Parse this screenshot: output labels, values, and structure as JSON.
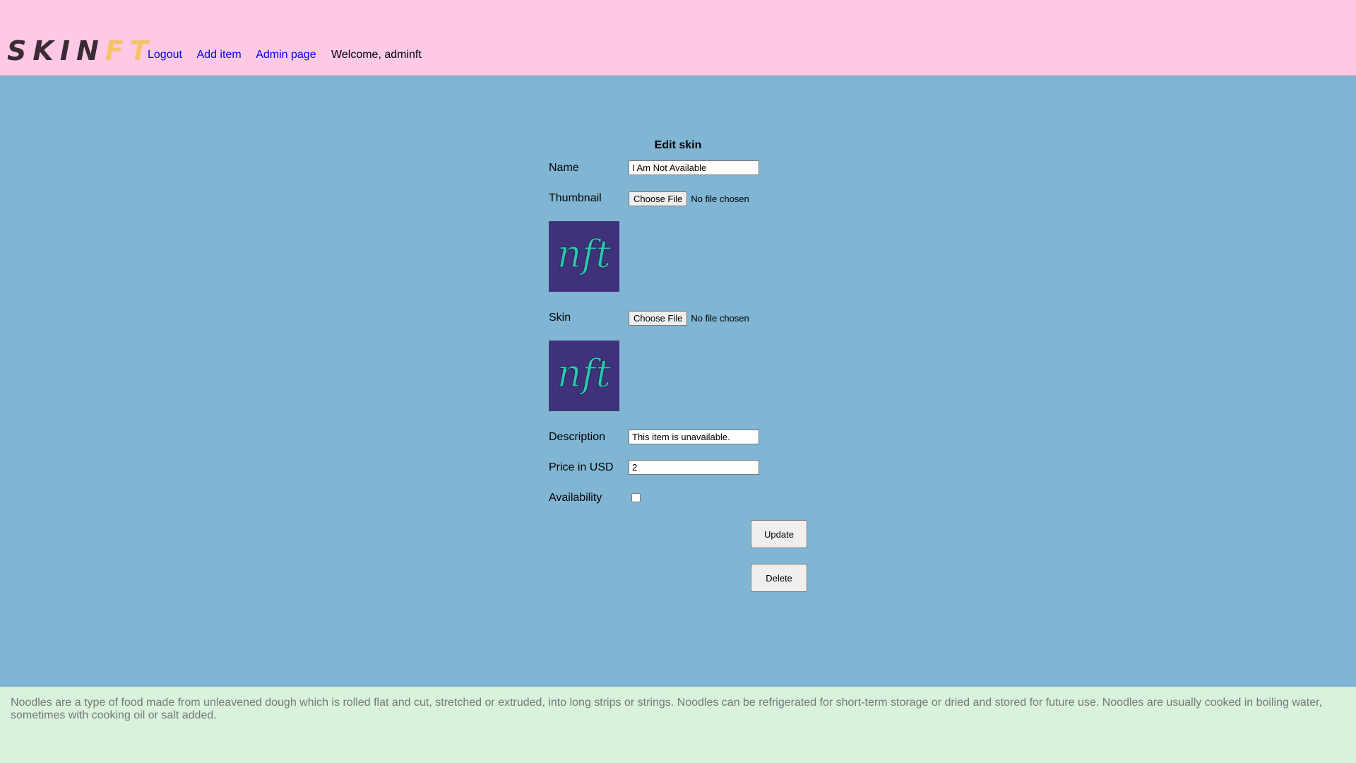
{
  "header": {
    "logo": {
      "part1": "SKIN",
      "part2": "FT"
    },
    "nav": {
      "logout": "Logout",
      "add_item": "Add item",
      "admin_page": "Admin page",
      "welcome": "Welcome, adminft"
    }
  },
  "form": {
    "title": "Edit skin",
    "name": {
      "label": "Name",
      "value": "I Am Not Available"
    },
    "thumbnail": {
      "label": "Thumbnail",
      "button": "Choose File",
      "status": "No file chosen",
      "preview_text": "nft"
    },
    "skin": {
      "label": "Skin",
      "button": "Choose File",
      "status": "No file chosen",
      "preview_text": "nft"
    },
    "description": {
      "label": "Description",
      "value": "This item is unavailable."
    },
    "price": {
      "label": "Price in USD",
      "value": "2"
    },
    "availability": {
      "label": "Availability",
      "checked": false
    },
    "update_button": "Update",
    "delete_button": "Delete"
  },
  "footer": {
    "text": "Noodles are a type of food made from unleavened dough which is rolled flat and cut, stretched or extruded, into long strips or strings. Noodles can be refrigerated for short-term storage or dried and stored for future use. Noodles are usually cooked in boiling water, sometimes with cooking oil or salt added."
  },
  "colors": {
    "header_bg": "#fdc9e4",
    "main_bg": "#80b6d4",
    "footer_bg": "#d9f2dc",
    "logo_dark": "#3a2b34",
    "logo_accent": "#f3c46b",
    "link": "#0000ee",
    "thumb_bg": "#40327a",
    "thumb_script": "#2fc7b0"
  }
}
